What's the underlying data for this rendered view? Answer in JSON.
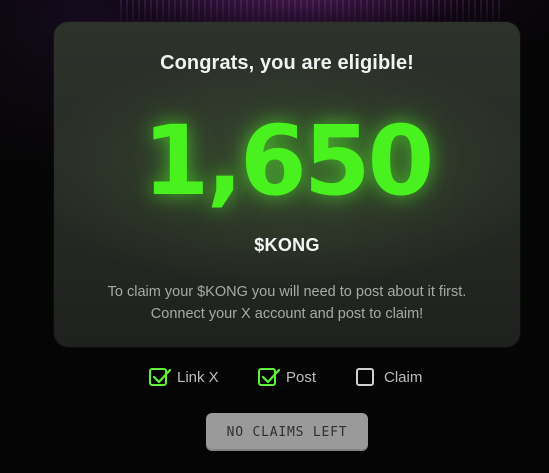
{
  "card": {
    "title": "Congrats, you are eligible!",
    "amount": "1,650",
    "ticker": "$KONG",
    "description": "To claim your $KONG you will need to post about it first. Connect your X account and post to claim!"
  },
  "steps": [
    {
      "label": "Link X",
      "checked": true
    },
    {
      "label": "Post",
      "checked": true
    },
    {
      "label": "Claim",
      "checked": false
    }
  ],
  "claim_button": {
    "label": "NO CLAIMS LEFT",
    "disabled": true
  },
  "colors": {
    "accent_green": "#49f21e",
    "checkbox_green": "#5ff13a",
    "card_bg": "#2a2e27",
    "button_bg": "#9a9a9a"
  }
}
